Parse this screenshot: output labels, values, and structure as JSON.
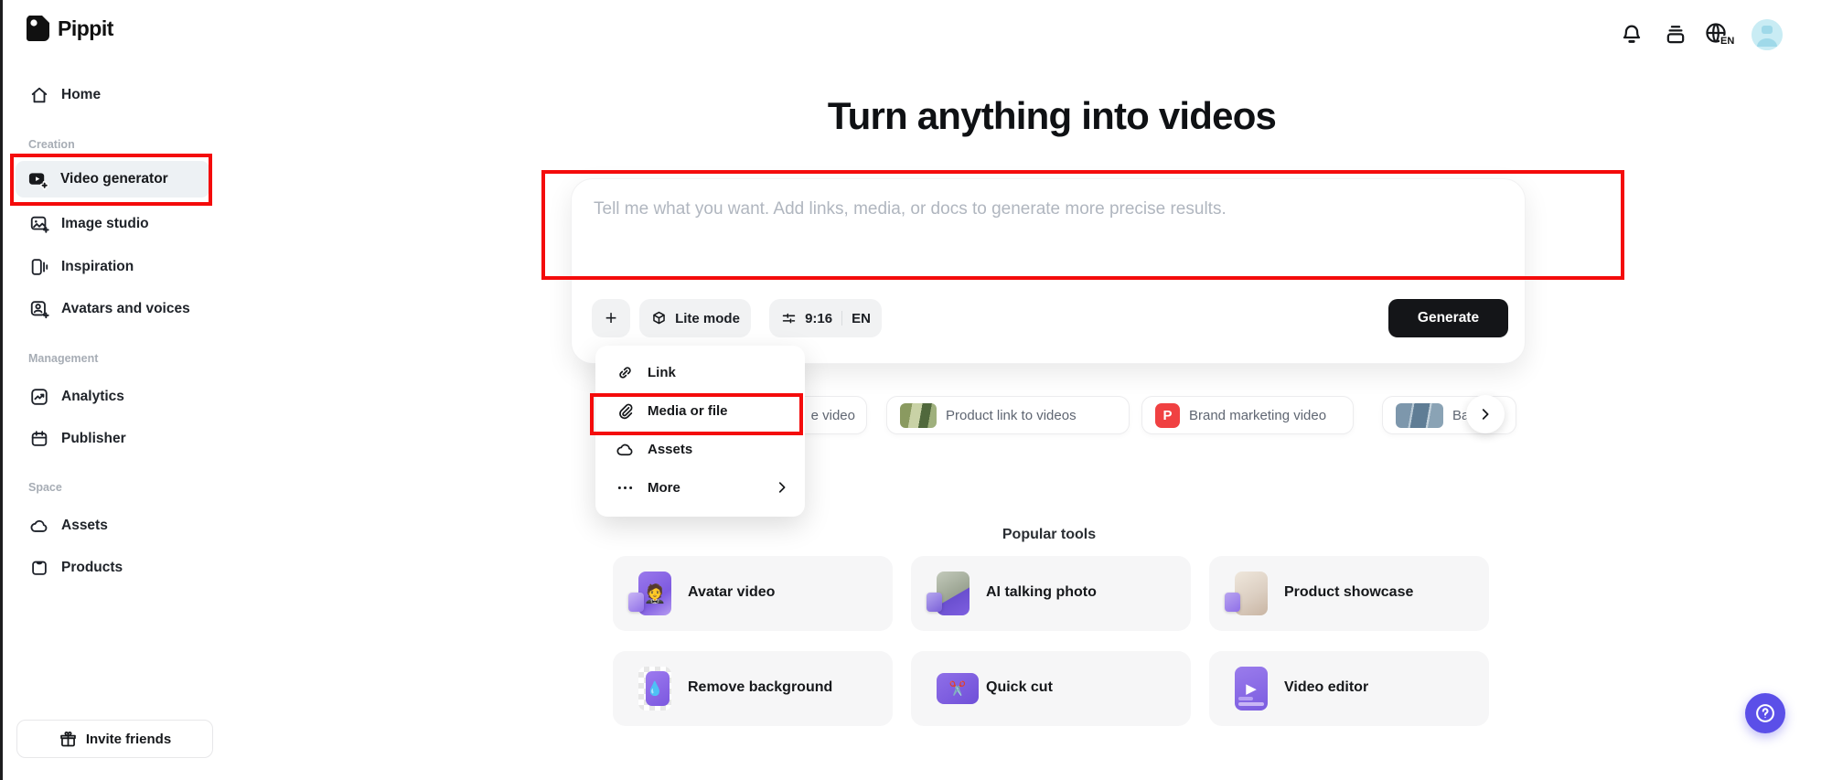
{
  "app": {
    "name": "Pippit"
  },
  "header": {
    "language": "EN",
    "icons": [
      "notification-bell",
      "card-stack",
      "language-globe",
      "user-avatar"
    ]
  },
  "sidebar": {
    "home": {
      "label": "Home"
    },
    "sections": [
      {
        "label": "Creation",
        "items": [
          {
            "label": "Video generator",
            "active": true
          },
          {
            "label": "Image studio"
          },
          {
            "label": "Inspiration"
          },
          {
            "label": "Avatars and voices"
          }
        ]
      },
      {
        "label": "Management",
        "items": [
          {
            "label": "Analytics"
          },
          {
            "label": "Publisher"
          }
        ]
      },
      {
        "label": "Space",
        "items": [
          {
            "label": "Assets"
          },
          {
            "label": "Products"
          }
        ]
      }
    ],
    "invite": {
      "label": "Invite friends"
    }
  },
  "main": {
    "title": "Turn anything into videos",
    "prompt": {
      "value": "",
      "placeholder": "Tell me what you want. Add links, media, or docs to generate more precise results."
    },
    "toolbar": {
      "add_label": "+",
      "lite_mode_label": "Lite mode",
      "ratio_label": "9:16",
      "language_label": "EN",
      "generate_label": "Generate"
    },
    "attach_menu": {
      "items": [
        {
          "label": "Link"
        },
        {
          "label": "Media or file",
          "annotated": true
        },
        {
          "label": "Assets"
        },
        {
          "label": "More",
          "has_submenu": true
        }
      ]
    },
    "suggestions": [
      {
        "label": "e video",
        "note": "partially hidden by menu"
      },
      {
        "label": "Product link to videos"
      },
      {
        "label": "Brand marketing video",
        "badge": "P"
      },
      {
        "label": "Ba",
        "note": "clipped at right edge"
      }
    ],
    "popular_tools": {
      "title": "Popular tools",
      "cards": [
        {
          "label": "Avatar video"
        },
        {
          "label": "AI talking photo"
        },
        {
          "label": "Product showcase"
        },
        {
          "label": "Remove background"
        },
        {
          "label": "Quick cut"
        },
        {
          "label": "Video editor"
        }
      ]
    }
  },
  "colors": {
    "annotation_red": "#f40b0b",
    "generate_black": "#141518",
    "help_purple": "#5b4fe8",
    "brand_badge_red": "#f04142",
    "avatar_blue": "#c9ecf4",
    "active_item_bg": "#edf1f4"
  }
}
